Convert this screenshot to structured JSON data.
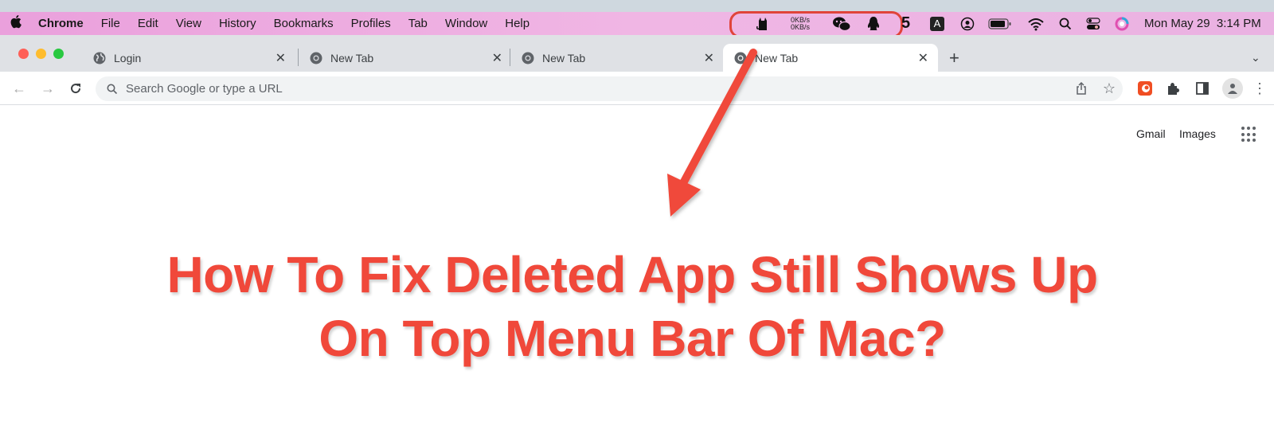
{
  "menubar": {
    "app_name": "Chrome",
    "items": [
      "File",
      "Edit",
      "View",
      "History",
      "Bookmarks",
      "Profiles",
      "Tab",
      "Window",
      "Help"
    ],
    "status": {
      "net_up": "0KB/s",
      "net_down": "0KB/s",
      "input_method": "A",
      "datetime": "Mon May 29  3:14 PM"
    }
  },
  "tabs": [
    {
      "label": "Login",
      "icon": "globe-icon",
      "active": false
    },
    {
      "label": "New Tab",
      "icon": "chrome-icon",
      "active": false
    },
    {
      "label": "New Tab",
      "icon": "chrome-icon",
      "active": false
    },
    {
      "label": "New Tab",
      "icon": "chrome-icon",
      "active": true
    }
  ],
  "toolbar": {
    "omnibox_placeholder": "Search Google or type a URL"
  },
  "ntp": {
    "gmail_label": "Gmail",
    "images_label": "Images"
  },
  "headline": {
    "line1": "How To Fix Deleted App Still Shows Up",
    "line2": "On Top Menu Bar Of Mac?"
  },
  "colors": {
    "accent_red": "#f0483a",
    "menubar_pink": "#eeb0e2"
  }
}
